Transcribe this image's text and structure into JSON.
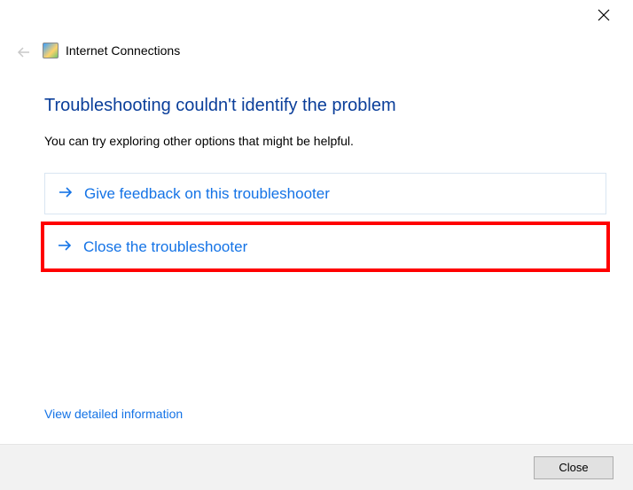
{
  "window": {
    "title": "Internet Connections"
  },
  "main": {
    "heading": "Troubleshooting couldn't identify the problem",
    "subtext": "You can try exploring other options that might be helpful.",
    "options": [
      {
        "label": "Give feedback on this troubleshooter"
      },
      {
        "label": "Close the troubleshooter"
      }
    ],
    "detail_link": "View detailed information"
  },
  "footer": {
    "close_label": "Close"
  },
  "colors": {
    "heading_blue": "#0a3e9a",
    "link_blue": "#1473e6",
    "highlight_red": "#ff0000"
  }
}
